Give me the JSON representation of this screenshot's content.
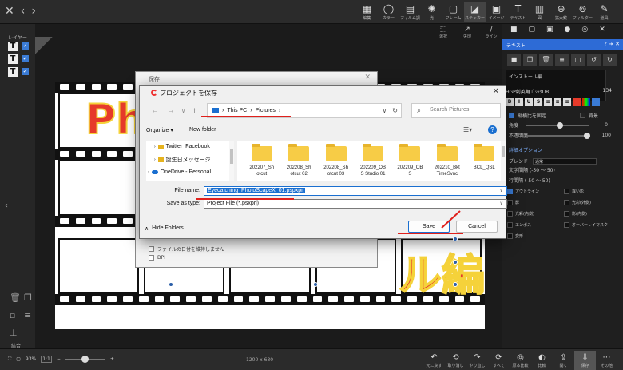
{
  "topbar": {
    "tools": [
      {
        "icon": "edit-icon",
        "glyph": "▦",
        "label": "編集"
      },
      {
        "icon": "color-icon",
        "glyph": "◯",
        "label": "カラー"
      },
      {
        "icon": "film-icon",
        "glyph": "▤",
        "label": "フィルム調"
      },
      {
        "icon": "light-icon",
        "glyph": "✺",
        "label": "光"
      },
      {
        "icon": "frame-icon",
        "glyph": "▢",
        "label": "フレーム"
      },
      {
        "icon": "sticker-icon",
        "glyph": "◪",
        "label": "ステッカー"
      },
      {
        "icon": "image-icon",
        "glyph": "▣",
        "label": "イメージ"
      },
      {
        "icon": "text-icon",
        "glyph": "T",
        "label": "テキスト"
      },
      {
        "icon": "grid-icon",
        "glyph": "▥",
        "label": "図"
      },
      {
        "icon": "zoom-icon",
        "glyph": "⊕",
        "label": "拡大鏡"
      },
      {
        "icon": "filter-icon",
        "glyph": "⊚",
        "label": "フィルター"
      },
      {
        "icon": "tool-icon",
        "glyph": "✎",
        "label": "道具"
      }
    ]
  },
  "left": {
    "layer_label": "レイヤー",
    "merge_label": "結合"
  },
  "subtools": [
    {
      "icon": "select-icon",
      "glyph": "⬚",
      "label": "選択"
    },
    {
      "icon": "arrow-icon",
      "glyph": "↗",
      "label": "矢印"
    },
    {
      "icon": "line-icon",
      "glyph": "/",
      "label": "ライン"
    }
  ],
  "right_panel": {
    "title": "テキスト",
    "text_content": "インストール編",
    "font_name": "HGP創英角ｺﾞｼｯｸUB",
    "font_size": "134",
    "vertical_label": "縦横比を固定",
    "background_label": "背景",
    "angle_label": "角度",
    "angle_value": "0",
    "opacity_label": "不透明度",
    "opacity_value": "100",
    "advanced_label": "詳細オプション",
    "blend_label": "ブレンド",
    "blend_value": "通常",
    "char_spacing_label": "文字間隔 (-50 ～ 50)",
    "line_spacing_label": "行間隔 (-50 ～ 50)",
    "effects": [
      "アウトライン",
      "異い影",
      "影",
      "光彩(外側)",
      "光彩(内側)",
      "影(内側)",
      "エンボス",
      "オーバーレイマスク",
      "変形",
      ""
    ]
  },
  "canvas_text": {
    "line1": "Ph",
    "line2": "ル編"
  },
  "bottombar": {
    "zoom": "93%",
    "zoom_btn": "1:1",
    "dimensions": "1200 x 630",
    "tools": [
      {
        "icon": "undo-icon",
        "glyph": "↶",
        "label": "元に戻す"
      },
      {
        "icon": "undo-all-icon",
        "glyph": "⟲",
        "label": "取り消し"
      },
      {
        "icon": "redo-icon",
        "glyph": "↷",
        "label": "やり直し"
      },
      {
        "icon": "redo-all-icon",
        "glyph": "⟳",
        "label": "すべて"
      },
      {
        "icon": "compare-icon",
        "glyph": "◎",
        "label": "原本比較"
      },
      {
        "icon": "compare2-icon",
        "glyph": "◐",
        "label": "比較"
      },
      {
        "icon": "open-icon",
        "glyph": "⇪",
        "label": "開く"
      },
      {
        "icon": "save-icon",
        "glyph": "⇩",
        "label": "保存"
      },
      {
        "icon": "more-icon",
        "glyph": "⋯",
        "label": "その他"
      }
    ]
  },
  "back_dialog": {
    "title": "保存",
    "option1": "ファイルの日付を維持しません",
    "option2": "DPI"
  },
  "dialog": {
    "title": "プロジェクトを保存",
    "breadcrumb": [
      "This PC",
      "Pictures"
    ],
    "search_placeholder": "Search Pictures",
    "organize": "Organize ▾",
    "new_folder": "New folder",
    "nav_items": [
      "Twitter_Facebook",
      "誕生日メッセージ",
      "OneDrive - Personal"
    ],
    "folders": [
      "202207_Sh\notcut",
      "202208_Sh\notcut 02",
      "202208_Sh\notcut 03",
      "202209_OB\nS Studio 01",
      "202209_OB\nS",
      "202210_Bkt\nTimeSvnc",
      "BCL_QSL"
    ],
    "file_name_label": "File name:",
    "file_name_value": "Eyecatching_PhotoScapeX_01.pspxprj",
    "save_type_label": "Save as type:",
    "save_type_value": "Project File (*.psxprj)",
    "hide_folders": "Hide Folders",
    "save_button": "Save",
    "cancel_button": "Cancel"
  },
  "colors": {
    "accent": "#1a6fd0",
    "annotation": "#e0201c"
  }
}
